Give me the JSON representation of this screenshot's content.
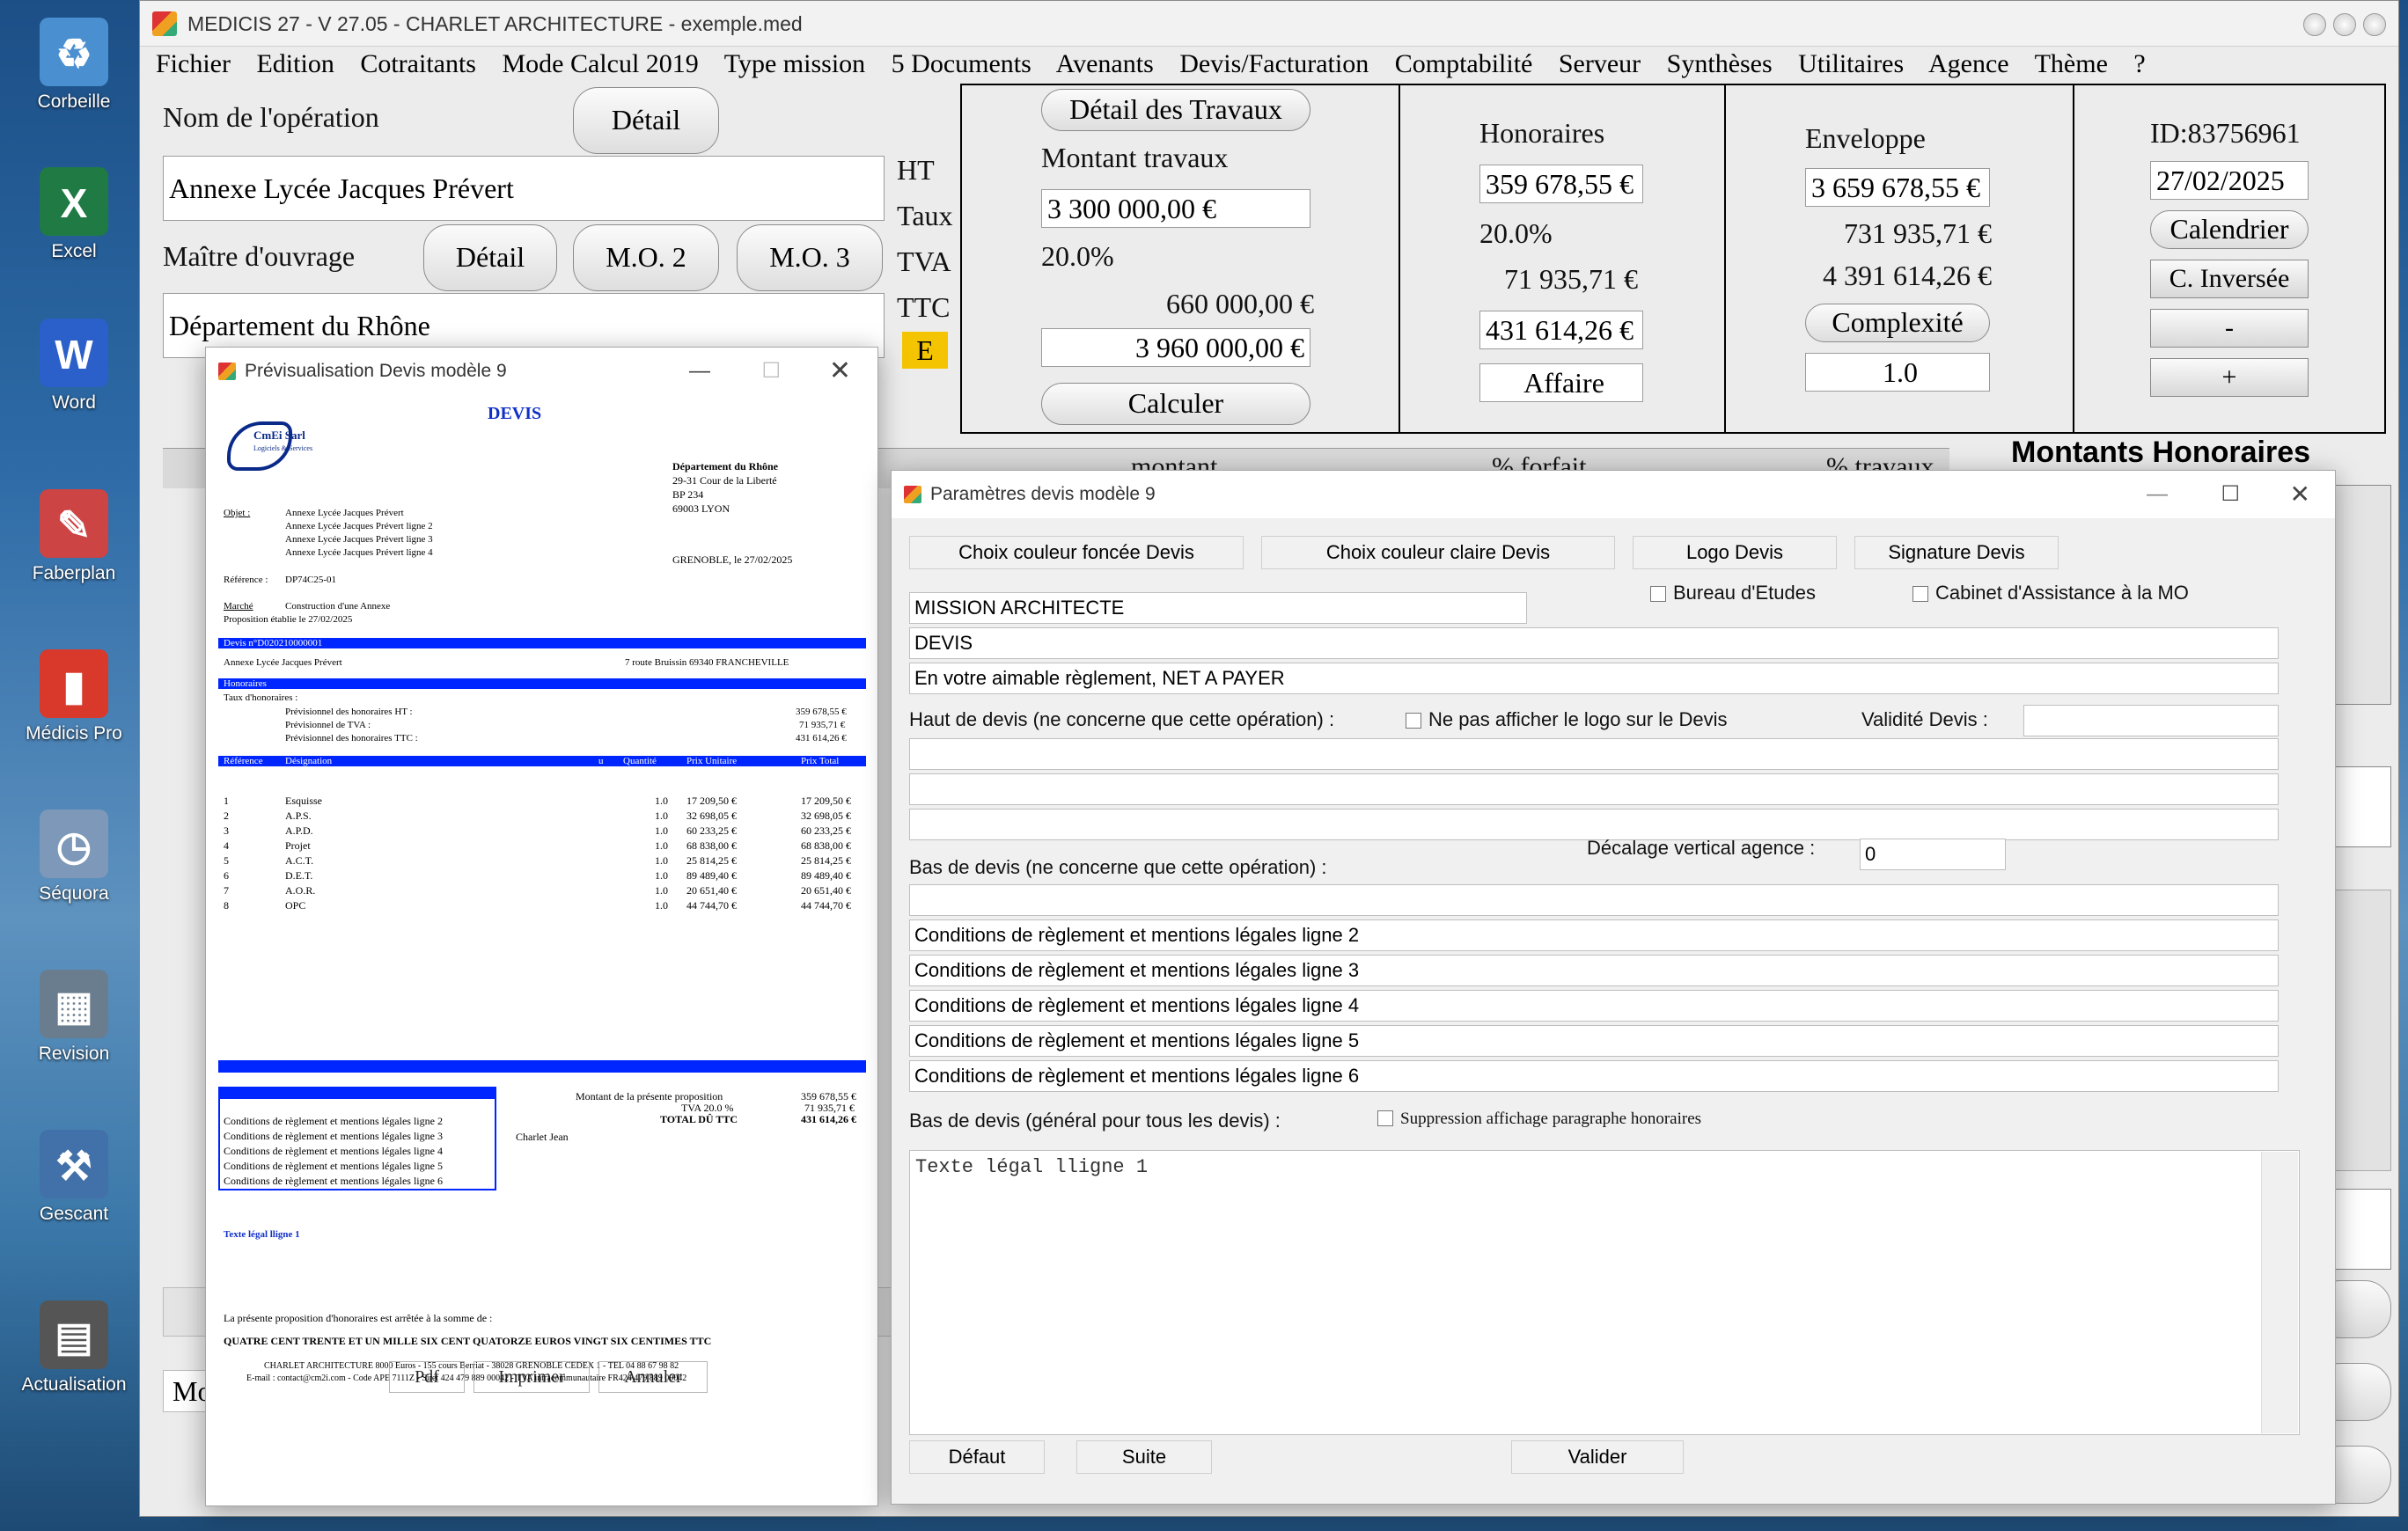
{
  "desktop": {
    "icons": [
      {
        "label": "Corbeille",
        "icon": "recycle-bin-icon",
        "color": "#4a8fd0",
        "glyph": "♻"
      },
      {
        "label": "Excel",
        "icon": "excel-icon",
        "color": "#1f7a44",
        "glyph": "X"
      },
      {
        "label": "Word",
        "icon": "word-icon",
        "color": "#2b5fc9",
        "glyph": "W"
      },
      {
        "label": "Faberplan",
        "icon": "faberplan-icon",
        "color": "#c44",
        "glyph": "✎"
      },
      {
        "label": "Médicis Pro",
        "icon": "medicis-pro-icon",
        "color": "#d8392b",
        "glyph": "▮"
      },
      {
        "label": "Séquora",
        "icon": "sequora-icon",
        "color": "#7d98b8",
        "glyph": "◷"
      },
      {
        "label": "Revision",
        "icon": "revision-icon",
        "color": "#6a7d8f",
        "glyph": "▦"
      },
      {
        "label": "Gescant",
        "icon": "gescant-icon",
        "color": "#4270a8",
        "glyph": "⚒"
      },
      {
        "label": "Actualisation",
        "icon": "actualisation-icon",
        "color": "#555",
        "glyph": "▤"
      }
    ]
  },
  "main": {
    "title": "MEDICIS 27   - V 27.05 - CHARLET ARCHITECTURE - exemple.med",
    "menu": [
      "Fichier",
      "Edition",
      "Cotraitants",
      "Mode Calcul 2019",
      "Type mission",
      "5 Documents",
      "Avenants",
      "Devis/Facturation",
      "Comptabilité",
      "Serveur",
      "Synthèses",
      "Utilitaires",
      "Agence",
      "Thème",
      "?"
    ],
    "operation_label": "Nom de l'opération",
    "detail_label": "Détail",
    "operation_value": "Annexe Lycée Jacques Prévert",
    "maitre_label": "Maître d'ouvrage",
    "mo2": "M.O. 2",
    "mo3": "M.O. 3",
    "maitre_value": "Département du Rhône",
    "ht": "HT",
    "taux": "Taux",
    "tva": "TVA",
    "ttc": "TTC",
    "e_badge": "E",
    "travaux": {
      "detail_btn": "Détail des Travaux",
      "montant_label": "Montant travaux",
      "montant_ht": "3 300 000,00 €",
      "taux": "20.0%",
      "tva": "660 000,00 €",
      "ttc": "3 960 000,00 €",
      "calc_btn": "Calculer"
    },
    "honoraires": {
      "title": "Honoraires",
      "ht": "359 678,55 €",
      "taux": "20.0%",
      "tva": "71 935,71 €",
      "ttc": "431 614,26 €",
      "affaire_btn": "Affaire"
    },
    "enveloppe": {
      "title": "Enveloppe",
      "ht": "3 659 678,55 €",
      "tva": "731 935,71 €",
      "ttc": "4 391 614,26 €",
      "complexite_btn": "Complexité",
      "complexite_val": "1.0"
    },
    "idpanel": {
      "id": "ID:83756961",
      "date": "27/02/2025",
      "calendrier": "Calendrier",
      "cinverse": "C. Inversée",
      "minus": "-",
      "plus": "+"
    },
    "montants_title": "Montants Honoraires",
    "col_montant": "montant",
    "col_forfait": "% forfait",
    "col_travaux": "% travaux",
    "mo_fragment": "Mo"
  },
  "preview": {
    "title": "Prévisualisation Devis modèle 9",
    "heading": "DEVIS",
    "company": "CmEi Sarl",
    "company_sub": "Logiciels & Services",
    "client": {
      "name": "Département du Rhône",
      "addr1": "29-31 Cour de la Liberté",
      "addr2": "BP 234",
      "city": "69003 LYON"
    },
    "place_date": "GRENOBLE, le 27/02/2025",
    "objet_label": "Objet :",
    "objet_lines": [
      "Annexe Lycée Jacques Prévert",
      "Annexe Lycée Jacques Prévert ligne 2",
      "Annexe Lycée Jacques Prévert ligne 3",
      "Annexe Lycée Jacques Prévert ligne 4"
    ],
    "ref_label": "Référence :",
    "ref_value": "DP74C25-01",
    "marche_label": "Marché",
    "marche_value": "Construction d'une Annexe",
    "proposition": "Proposition établie le 27/02/2025",
    "devis_no": "Devis n°D020210000001",
    "project": "Annexe Lycée Jacques Prévert",
    "address": "7 route Bruissin 69340 FRANCHEVILLE",
    "honoraires_hdr": "Honoraires",
    "taux_hon": "Taux d'honoraires :",
    "prev": [
      {
        "l": "Prévisionnel des honoraires HT :",
        "v": "359 678,55 €"
      },
      {
        "l": "Prévisionnel de TVA :",
        "v": "71 935,71 €"
      },
      {
        "l": "Prévisionnel des honoraires TTC :",
        "v": "431 614,26 €"
      }
    ],
    "table_headers": [
      "Référence",
      "Désignation",
      "u",
      "Quantité",
      "Prix Unitaire",
      "Prix Total"
    ],
    "rows": [
      {
        "ref": "1",
        "des": "Esquisse",
        "q": "1.0",
        "pu": "17 209,50 €",
        "pt": "17 209,50 €"
      },
      {
        "ref": "2",
        "des": "A.P.S.",
        "q": "1.0",
        "pu": "32 698,05 €",
        "pt": "32 698,05 €"
      },
      {
        "ref": "3",
        "des": "A.P.D.",
        "q": "1.0",
        "pu": "60 233,25 €",
        "pt": "60 233,25 €"
      },
      {
        "ref": "4",
        "des": "Projet",
        "q": "1.0",
        "pu": "68 838,00 €",
        "pt": "68 838,00 €"
      },
      {
        "ref": "5",
        "des": "A.C.T.",
        "q": "1.0",
        "pu": "25 814,25 €",
        "pt": "25 814,25 €"
      },
      {
        "ref": "6",
        "des": "D.E.T.",
        "q": "1.0",
        "pu": "89 489,40 €",
        "pt": "89 489,40 €"
      },
      {
        "ref": "7",
        "des": "A.O.R.",
        "q": "1.0",
        "pu": "20 651,40 €",
        "pt": "20 651,40 €"
      },
      {
        "ref": "8",
        "des": "OPC",
        "q": "1.0",
        "pu": "44 744,70 €",
        "pt": "44 744,70 €"
      }
    ],
    "totals": [
      {
        "l": "Montant de la présente proposition",
        "v": "359 678,55 €"
      },
      {
        "l": "TVA 20.0 %",
        "v": "71 935,71 €"
      },
      {
        "l": "TOTAL DÛ TTC",
        "v": "431 614,26 €"
      }
    ],
    "conditions": [
      "Conditions de règlement et mentions légales ligne 2",
      "Conditions de règlement et mentions légales ligne 3",
      "Conditions de règlement et mentions légales ligne 4",
      "Conditions de règlement et mentions légales ligne 5",
      "Conditions de règlement et mentions légales ligne 6"
    ],
    "signature": "Charlet Jean",
    "texte_legal": "Texte légal lligne 1",
    "arrete": "La présente proposition d'honoraires est arrêtée à la somme de :",
    "amount_words": "QUATRE CENT TRENTE ET UN MILLE SIX CENT QUATORZE EUROS VINGT SIX CENTIMES TTC",
    "footer1": "CHARLET ARCHITECTURE 8000 Euros - 155 cours Berriat - 38028 GRENOBLE CEDEX 1 - TEL 04 88 67 98 82",
    "footer2": "E-mail : contact@cm2i.com - Code APE 7111Z - Siret 424 479 889 00042 - TVA intracommunautaire FR424 479 889 00042",
    "btn_pdf": "Pdf",
    "btn_print": "Imprimer",
    "btn_cancel": "Annuler"
  },
  "params": {
    "title": "Paramètres devis modèle 9",
    "btn_dark": "Choix couleur foncée Devis",
    "btn_light": "Choix couleur claire Devis",
    "btn_logo": "Logo Devis",
    "btn_sign": "Signature Devis",
    "mission": "MISSION ARCHITECTE",
    "bureau": "Bureau d'Etudes",
    "cabinet": "Cabinet d'Assistance à la MO",
    "devis": "DEVIS",
    "reglement": "En votre aimable règlement, NET A PAYER",
    "haut_label": "Haut de devis (ne concerne que cette opération) :",
    "no_logo": "Ne pas afficher le logo sur le Devis",
    "validite": "Validité Devis :",
    "bas_label": "Bas de devis  (ne concerne que cette opération) :",
    "decalage": "Décalage vertical agence :",
    "decalage_val": "0",
    "conds": [
      "Conditions de règlement et mentions légales ligne 2",
      "Conditions de règlement et mentions légales ligne 3",
      "Conditions de règlement et mentions légales ligne 4",
      "Conditions de règlement et mentions légales ligne 5",
      "Conditions de règlement et mentions légales ligne 6"
    ],
    "bas_general": "Bas de devis  (général pour tous les devis) :",
    "suppression": "Suppression affichage paragraphe honoraires",
    "texte": "Texte légal lligne 1",
    "btn_defaut": "Défaut",
    "btn_suite": "Suite",
    "btn_valider": "Valider"
  },
  "colors": {
    "accent_blue": "#0026ff",
    "badge_yellow": "#f5c400"
  }
}
